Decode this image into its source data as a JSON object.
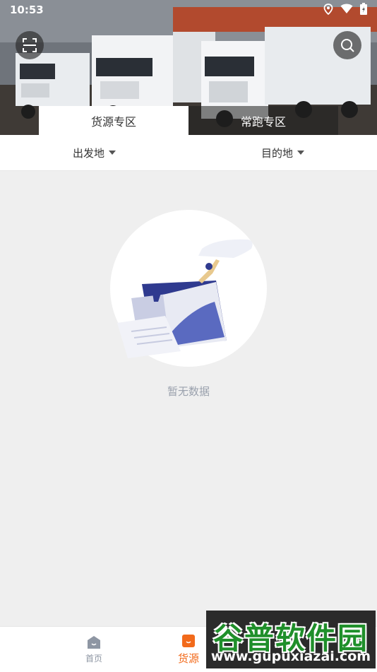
{
  "status_bar": {
    "time": "10:53",
    "icons": [
      "location-icon",
      "wifi-icon",
      "battery-icon"
    ]
  },
  "header": {
    "left_button_icon": "scan-icon",
    "right_button_icon": "search-icon",
    "tabs": [
      {
        "label": "货源专区",
        "active": true
      },
      {
        "label": "常跑专区",
        "active": false
      }
    ]
  },
  "filters": [
    {
      "label": "出发地",
      "icon": "caret-down-icon"
    },
    {
      "label": "目的地",
      "icon": "caret-down-icon"
    }
  ],
  "empty_state": {
    "icon": "empty-folder-illustration",
    "text": "暂无数据"
  },
  "bottom_nav": {
    "items": [
      {
        "label": "首页",
        "icon": "home-icon",
        "active": false
      },
      {
        "label": "货源",
        "icon": "cargo-icon",
        "active": true
      }
    ]
  },
  "watermark": {
    "title": "谷普软件园",
    "url": "www.gupuxiazai.com"
  },
  "colors": {
    "accent": "#f26a1b",
    "inactive_nav": "#8e96a3",
    "empty_text": "#9aa1ad",
    "illustration_navy": "#2f3a8f",
    "illustration_blue": "#5a6ac0"
  }
}
